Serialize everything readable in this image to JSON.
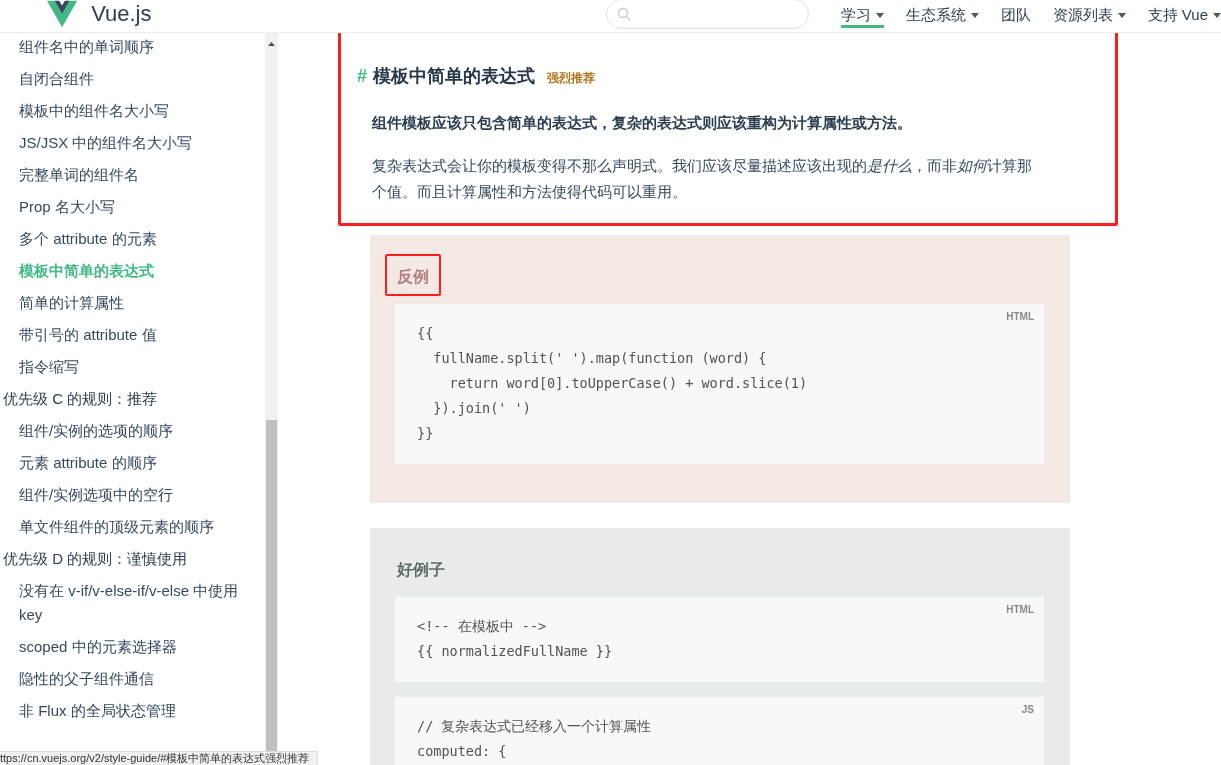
{
  "header": {
    "logo_text": "Vue.js",
    "nav": [
      {
        "label": "学习",
        "selected": true,
        "dropdown": true
      },
      {
        "label": "生态系统",
        "selected": false,
        "dropdown": true
      },
      {
        "label": "团队",
        "selected": false,
        "dropdown": false
      },
      {
        "label": "资源列表",
        "selected": false,
        "dropdown": true
      },
      {
        "label": "支持 Vue",
        "selected": false,
        "dropdown": true
      }
    ]
  },
  "sidebar": {
    "sections": [
      {
        "items": [
          {
            "label": "组件名中的单词顺序",
            "selected": false
          },
          {
            "label": "自闭合组件",
            "selected": false
          },
          {
            "label": "模板中的组件名大小写",
            "selected": false
          },
          {
            "label": "JS/JSX 中的组件名大小写",
            "selected": false
          },
          {
            "label": "完整单词的组件名",
            "selected": false
          },
          {
            "label": "Prop 名大小写",
            "selected": false
          },
          {
            "label": "多个 attribute 的元素",
            "selected": false
          },
          {
            "label": "模板中简单的表达式",
            "selected": true
          },
          {
            "label": "简单的计算属性",
            "selected": false
          },
          {
            "label": "带引号的 attribute 值",
            "selected": false
          },
          {
            "label": "指令缩写",
            "selected": false
          }
        ]
      },
      {
        "title": "优先级 C 的规则：推荐",
        "items": [
          {
            "label": "组件/实例的选项的顺序",
            "selected": false
          },
          {
            "label": "元素 attribute 的顺序",
            "selected": false
          },
          {
            "label": "组件/实例选项中的空行",
            "selected": false
          },
          {
            "label": "单文件组件的顶级元素的顺序",
            "selected": false
          }
        ]
      },
      {
        "title": "优先级 D 的规则：谨慎使用",
        "items": [
          {
            "label": "没有在 v-if/v-else-if/v-else 中使用 key",
            "selected": false
          },
          {
            "label": "scoped 中的元素选择器",
            "selected": false
          },
          {
            "label": "隐性的父子组件通信",
            "selected": false
          },
          {
            "label": "非 Flux 的全局状态管理",
            "selected": false
          }
        ]
      }
    ]
  },
  "section": {
    "highlighted": true,
    "hash": "#",
    "heading": "模板中简单的表达式",
    "badge": "强烈推荐",
    "lead": "组件模板应该只包含简单的表达式，复杂的表达式则应该重构为计算属性或方法。",
    "body": [
      {
        "text": "复杂表达式会让你的模板变得不那么声明式。我们应该尽量描述应该出现的",
        "italic": false
      },
      {
        "text": "是什么",
        "italic": true
      },
      {
        "text": "，而非",
        "italic": false
      },
      {
        "text": "如何",
        "italic": true
      },
      {
        "text": "计算那个值。而且计算属性和方法使得代码可以重用。",
        "italic": false
      }
    ]
  },
  "examples": [
    {
      "kind": "bad",
      "label": "反例",
      "highlighted": true,
      "code_blocks": [
        {
          "lang": "HTML",
          "lines": [
            "{{",
            "  fullName.split(' ').map(function (word) {",
            "    return word[0].toUpperCase() + word.slice(1)",
            "  }).join(' ')",
            "}}"
          ]
        }
      ]
    },
    {
      "kind": "good",
      "label": "好例子",
      "highlighted": false,
      "code_blocks": [
        {
          "lang": "HTML",
          "lines": [
            "<!-- 在模板中 -->",
            "{{ normalizedFullName }}"
          ]
        },
        {
          "lang": "JS",
          "lines": [
            "// 复杂表达式已经移入一个计算属性",
            "computed: {"
          ]
        }
      ]
    }
  ],
  "status_bar": {
    "url": "ttps://cn.vuejs.org/v2/style-guide/#模板中简单的表达式强烈推荐"
  }
}
